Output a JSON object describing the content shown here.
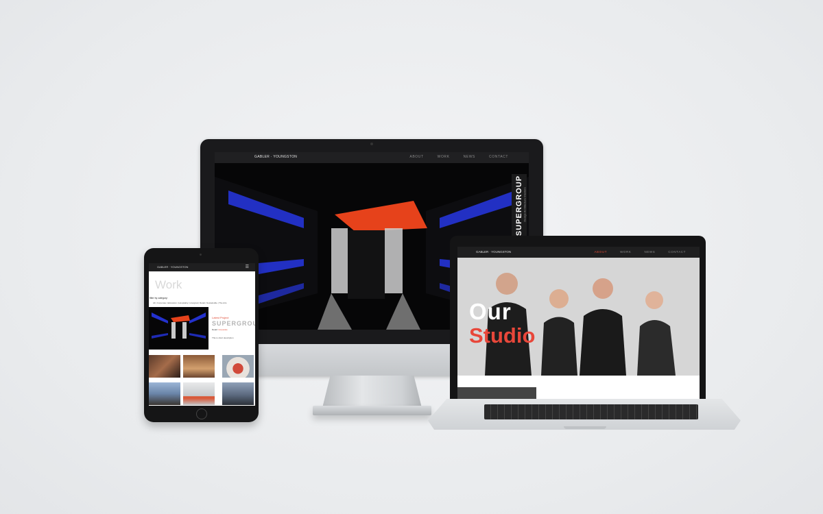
{
  "desktop": {
    "logo": "GABLER · YOUNGSTON",
    "nav": [
      "ABOUT",
      "WORK",
      "NEWS",
      "CONTACT"
    ],
    "hero_title": "SUPERGROUP",
    "hero_subtitle": "Design Architecture  Interiors"
  },
  "tablet": {
    "logo": "GABLER · YOUNGSTON",
    "menu_icon": "hamburger-icon",
    "page_title": "Work",
    "filter_label": "filter by category:",
    "filters": "All  |  Corporate  |  Education  |  Hospitality  |  Liturgical  |  Retail  |  Sustainable  |  The Arts",
    "latest_label": "Latest Project",
    "latest_title": "SUPERGROUP",
    "latest_meta_prefix": "Detail:",
    "latest_meta_value": "Corporate",
    "latest_desc": "This is short description"
  },
  "laptop": {
    "logo": "GABLER · YOUNGSTON",
    "nav": [
      "ABOUT",
      "WORK",
      "NEWS",
      "CONTACT"
    ],
    "active_nav": "ABOUT",
    "hero_line1": "Our",
    "hero_line2": "Studio"
  },
  "colors": {
    "accent": "#e8473a",
    "dark": "#1f1f20",
    "background": "#eceef0"
  }
}
